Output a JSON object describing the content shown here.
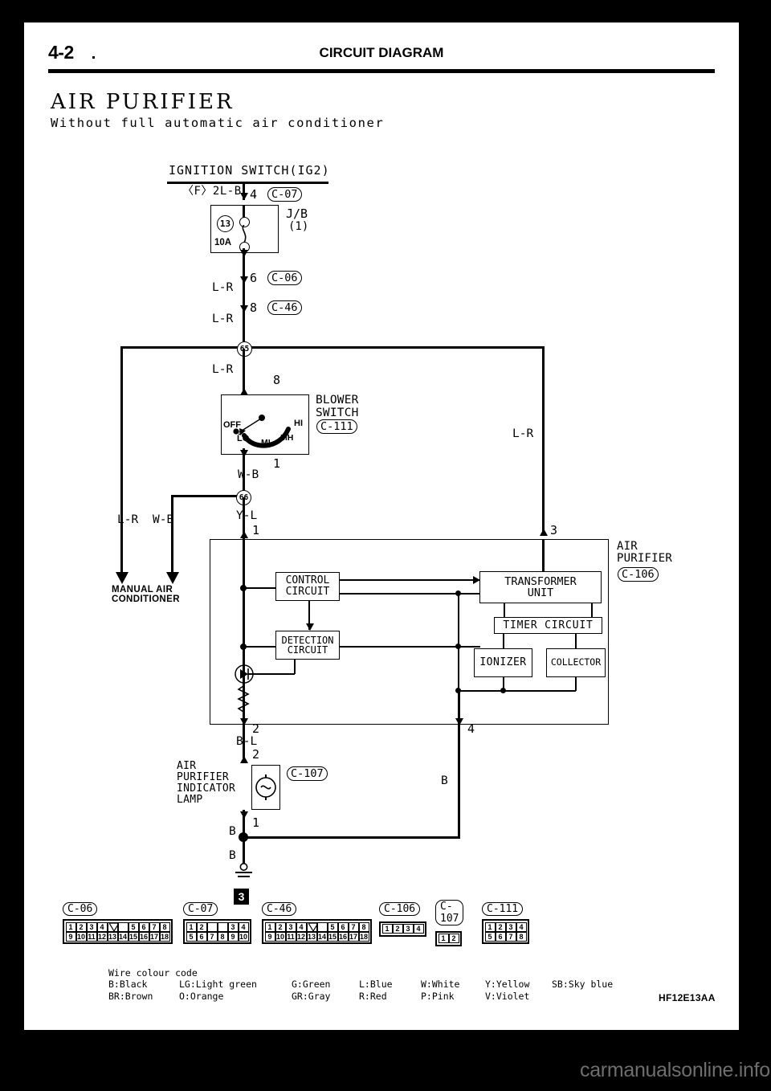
{
  "header": {
    "page_number": "4-2",
    "section_title": "CIRCUIT DIAGRAM"
  },
  "diagram": {
    "title": "AIR PURIFIER",
    "subtitle": "Without full automatic air conditioner",
    "doc_code": "HF12E13AA"
  },
  "watermark": "carmanualsonline.info",
  "labels": {
    "ignition_switch": "IGNITION SWITCH(IG2)",
    "source_wire": "〈F〉2L-B",
    "jb": "J/B",
    "jb_num": "(1)",
    "fuse_no": "13",
    "fuse_rating": "10A",
    "blower_switch": "BLOWER\nSWITCH",
    "blower_off": "OFF",
    "blower_lo": "LO",
    "blower_ml": "ML",
    "blower_mh": "MH",
    "blower_hi": "HI",
    "manual_ac": "MANUAL AIR\nCONDITIONER",
    "air_purifier": "AIR\nPURIFIER",
    "indicator_lamp": "AIR\nPURIFIER\nINDICATOR\nLAMP",
    "control_circuit": "CONTROL\nCIRCUIT",
    "detection_circuit": "DETECTION\nCIRCUIT",
    "transformer_unit": "TRANSFORMER\nUNIT",
    "timer_circuit": "TIMER CIRCUIT",
    "ionizer": "IONIZER",
    "collector": "COLLECTOR",
    "ground_label": "3"
  },
  "connector_tags": {
    "c07": "C-07",
    "c06": "C-06",
    "c46": "C-46",
    "c111": "C-111",
    "c106": "C-106",
    "c107": "C-107"
  },
  "junction_nodes": {
    "n65": "65",
    "n66": "66"
  },
  "wire_labels": {
    "lr_1": "L-R",
    "lr_2": "L-R",
    "lr_3": "L-R",
    "lr_right": "L-R",
    "lr_left": "L-R",
    "wb_1": "W-B",
    "wb_2": "W-B",
    "yl": "Y-L",
    "bl": "B-L",
    "b_right": "B",
    "b_1": "B",
    "b_2": "B"
  },
  "pin_numbers": {
    "p4": "4",
    "p6": "6",
    "p8_c46": "8",
    "p8_blower": "8",
    "p1_blower": "1",
    "p1_ap": "1",
    "p3_ap": "3",
    "p2_ap": "2",
    "p4_ap": "4",
    "p2_lamp_top": "2",
    "p2_lamp": "2",
    "p1_lamp": "1"
  },
  "connectors": [
    {
      "id": "C-06",
      "rows": [
        [
          "1",
          "2",
          "3",
          "4",
          "V",
          "",
          "5",
          "6",
          "7",
          "8"
        ],
        [
          "9",
          "10",
          "11",
          "12",
          "13",
          "14",
          "15",
          "16",
          "17",
          "18"
        ]
      ],
      "notch_index": 4
    },
    {
      "id": "C-07",
      "rows": [
        [
          "1",
          "2",
          "",
          "",
          "3",
          "4"
        ],
        [
          "5",
          "6",
          "7",
          "8",
          "9",
          "10"
        ]
      ],
      "notch_index": -1
    },
    {
      "id": "C-46",
      "rows": [
        [
          "1",
          "2",
          "3",
          "4",
          "V",
          "",
          "5",
          "6",
          "7",
          "8"
        ],
        [
          "9",
          "10",
          "11",
          "12",
          "13",
          "14",
          "15",
          "16",
          "17",
          "18"
        ]
      ],
      "notch_index": 4
    },
    {
      "id": "C-106",
      "rows": [
        [
          "1",
          "2",
          "3",
          "4"
        ]
      ],
      "notch_index": -1
    },
    {
      "id": "C-107",
      "rows": [
        [
          "1",
          "2"
        ]
      ],
      "notch_index": -1
    },
    {
      "id": "C-111",
      "rows": [
        [
          "1",
          "2",
          "3",
          "4"
        ],
        [
          "5",
          "6",
          "7",
          "8"
        ]
      ],
      "notch_index": -1
    }
  ],
  "wire_colour_code": {
    "title": "Wire colour code",
    "col1": [
      "B:Black",
      "BR:Brown"
    ],
    "col2": [
      "LG:Light green",
      "O:Orange"
    ],
    "col3": [
      "G:Green",
      "GR:Gray"
    ],
    "col4": [
      "L:Blue",
      "R:Red"
    ],
    "col5": [
      "W:White",
      "P:Pink"
    ],
    "col6": [
      "Y:Yellow",
      "V:Violet"
    ],
    "col7": [
      "SB:Sky blue",
      ""
    ]
  }
}
